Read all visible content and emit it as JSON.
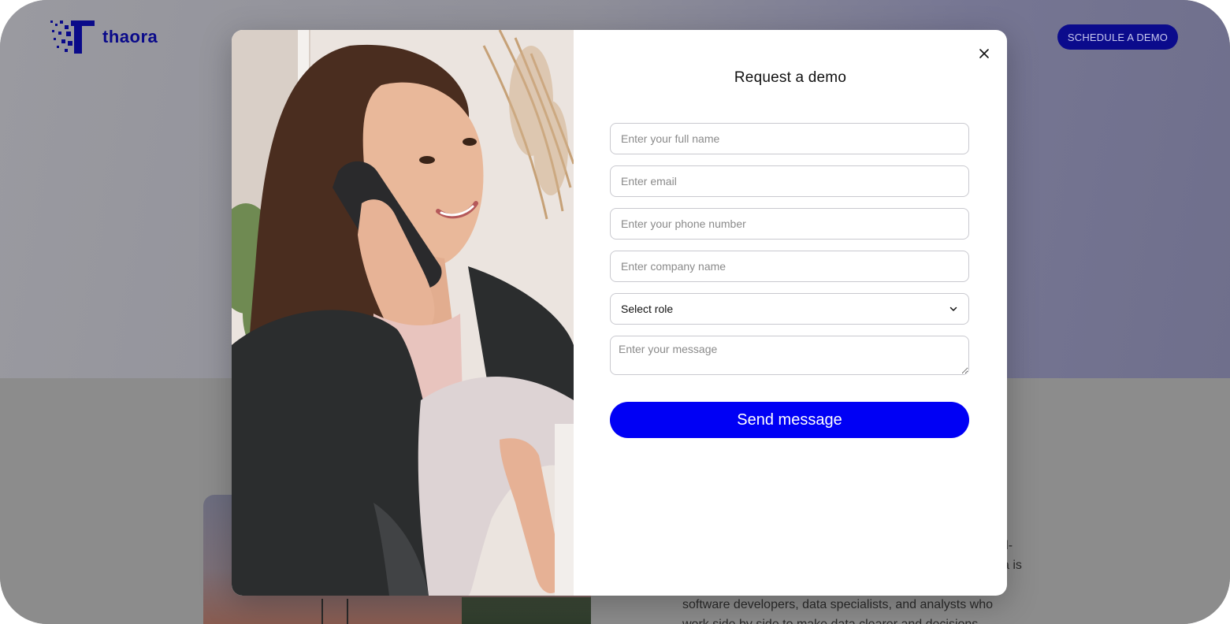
{
  "brand": {
    "name": "thaora",
    "color": "#0a0a8a"
  },
  "header": {
    "schedule_button": "SCHEDULE A DEMO"
  },
  "background_text": {
    "fragment_1": "nd-",
    "fragment_2": "a is",
    "line_3": "software developers, data specialists, and analysts who",
    "line_4": "work side by side to make data clearer and decisions"
  },
  "modal": {
    "title": "Request a demo",
    "close_icon": "close-icon",
    "fields": {
      "full_name_placeholder": "Enter your full name",
      "email_placeholder": "Enter email",
      "phone_placeholder": "Enter your phone number",
      "company_placeholder": "Enter company name",
      "role_selected": "Select role",
      "message_placeholder": "Enter your message"
    },
    "submit_label": "Send message",
    "accent_color": "#0000f5"
  }
}
